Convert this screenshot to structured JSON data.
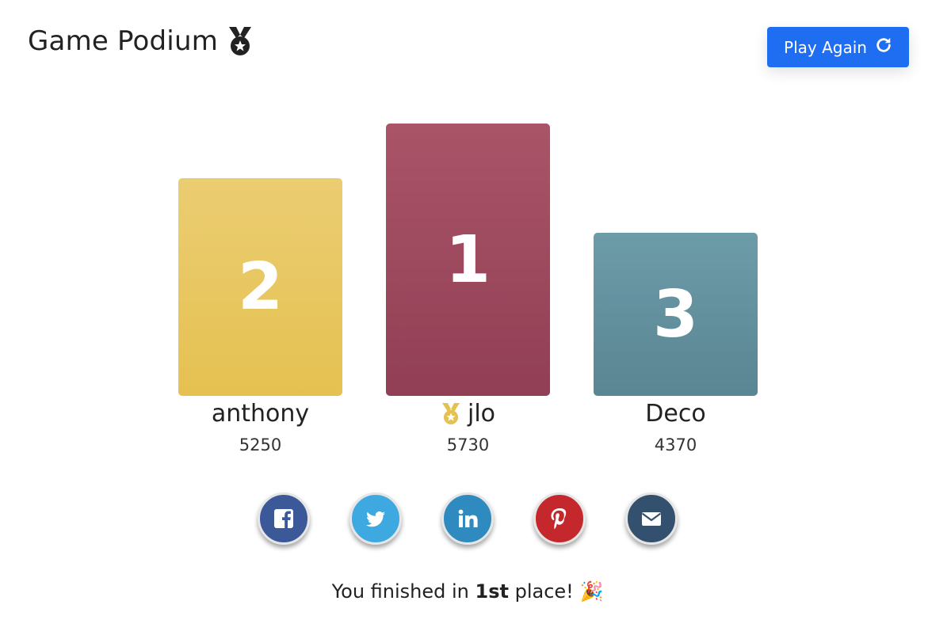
{
  "header": {
    "title": "Game Podium",
    "play_again_label": "Play Again"
  },
  "podium": [
    {
      "rank": "2",
      "name": "anthony",
      "score": "5250",
      "color": "#e8c865"
    },
    {
      "rank": "1",
      "name": "jlo",
      "score": "5730",
      "color": "#9e4a5f"
    },
    {
      "rank": "3",
      "name": "Deco",
      "score": "4370",
      "color": "#62909e"
    }
  ],
  "social": [
    {
      "icon": "facebook-icon",
      "color": "#3b5998"
    },
    {
      "icon": "twitter-icon",
      "color": "#3ea9e0"
    },
    {
      "icon": "linkedin-icon",
      "color": "#2f8bbf"
    },
    {
      "icon": "pinterest-icon",
      "color": "#c5282c"
    },
    {
      "icon": "email-icon",
      "color": "#34506f"
    }
  ],
  "result": {
    "prefix": "You finished in ",
    "place": "1st",
    "suffix": " place! ",
    "emoji": "🎉"
  },
  "colors": {
    "accent": "#1f6ef2"
  }
}
